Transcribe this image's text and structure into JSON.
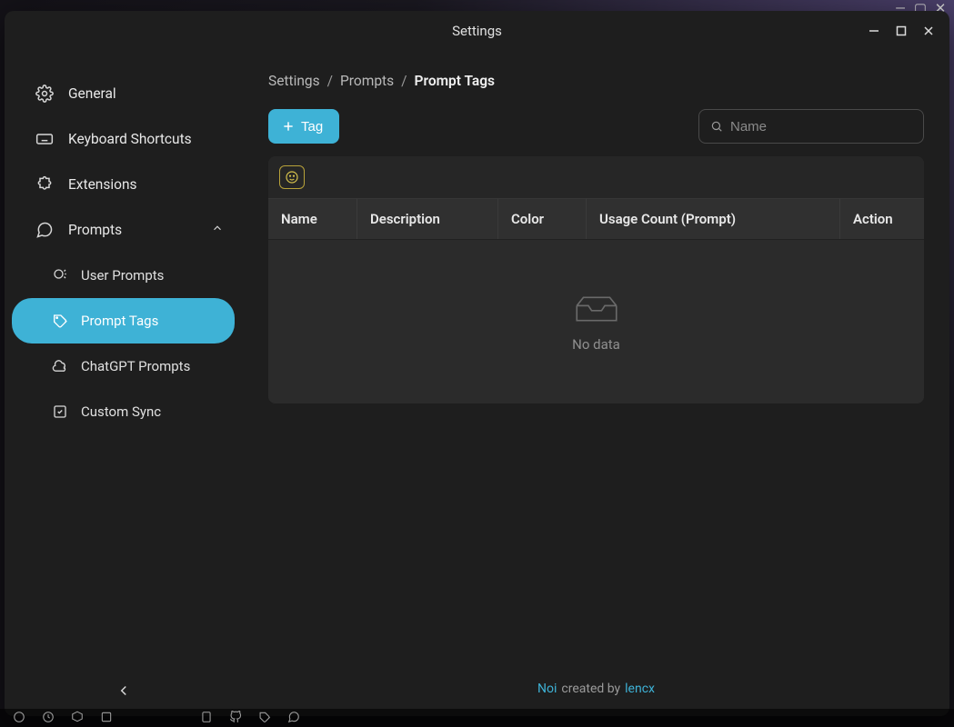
{
  "window": {
    "title": "Settings"
  },
  "sidebar": {
    "items": {
      "general": "General",
      "shortcuts": "Keyboard Shortcuts",
      "extensions": "Extensions",
      "prompts": "Prompts"
    },
    "sub": {
      "user_prompts": "User Prompts",
      "prompt_tags": "Prompt Tags",
      "chatgpt_prompts": "ChatGPT Prompts",
      "custom_sync": "Custom Sync"
    }
  },
  "breadcrumb": {
    "c1": "Settings",
    "c2": "Prompts",
    "c3": "Prompt Tags"
  },
  "toolbar": {
    "add_tag_label": "Tag",
    "search_placeholder": "Name"
  },
  "table": {
    "columns": {
      "name": "Name",
      "description": "Description",
      "color": "Color",
      "usage": "Usage Count (Prompt)",
      "action": "Action"
    },
    "empty": "No data"
  },
  "footer": {
    "app": "Noi",
    "by": "created by",
    "author": "lencx"
  }
}
